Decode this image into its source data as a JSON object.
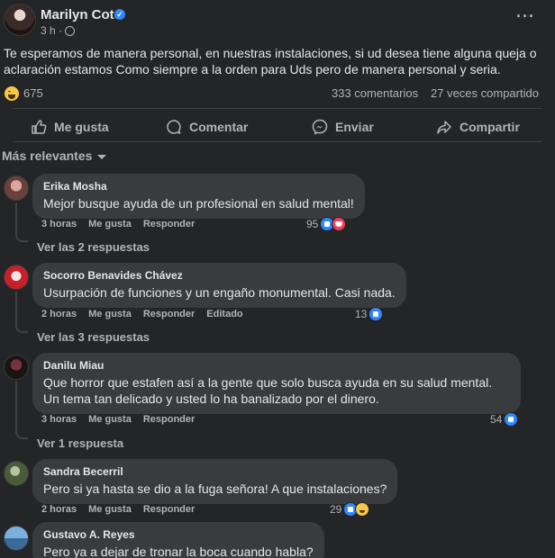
{
  "post": {
    "author": "Marilyn Cote",
    "time": "3 h ·",
    "text": "Te esperamos de manera personal, en nuestras instalaciones, si ud desea tiene alguna queja o aclaración estamos Como siempre a la orden para Uds pero de manera personal y seria.",
    "reactions_count": "675",
    "comments_count": "333 comentarios",
    "shares_count": "27 veces compartido"
  },
  "actions": {
    "like": "Me gusta",
    "comment": "Comentar",
    "send": "Enviar",
    "share": "Compartir"
  },
  "sort_label": "Más relevantes",
  "comments": [
    {
      "name": "Erika Mosha",
      "text": "Mejor busque ayuda de un profesional en salud mental!",
      "time": "3 horas",
      "like": "Me gusta",
      "reply": "Responder",
      "edited": "",
      "count": "95",
      "replies": "Ver las 2 respuestas"
    },
    {
      "name": "Socorro Benavides Chávez",
      "text": "Usurpación de funciones y un engaño monumental. Casi nada.",
      "time": "2 horas",
      "like": "Me gusta",
      "reply": "Responder",
      "edited": "Editado",
      "count": "13",
      "replies": "Ver las 3 respuestas"
    },
    {
      "name": "Danilu Miau",
      "text": "Que horror que estafen así a la gente que solo busca ayuda en su salud mental. Un tema tan delicado y usted lo ha banalizado por el dinero.",
      "time": "3 horas",
      "like": "Me gusta",
      "reply": "Responder",
      "edited": "",
      "count": "54",
      "replies": "Ver 1 respuesta"
    },
    {
      "name": "Sandra Becerril",
      "text": "Pero si ya hasta se dio a la fuga señora! A que instalaciones?",
      "time": "2 horas",
      "like": "Me gusta",
      "reply": "Responder",
      "edited": "",
      "count": "29",
      "replies": ""
    },
    {
      "name": "Gustavo A. Reyes",
      "text": "Pero ya a dejar de tronar la boca cuando habla?",
      "time": "",
      "like": "",
      "reply": "",
      "edited": "",
      "count": "",
      "replies": ""
    }
  ],
  "colors": {
    "background": "#242526",
    "bubble": "#3a3b3c",
    "accent": "#2d88ff",
    "text": "#e4e6eb",
    "muted": "#b0b3b8"
  }
}
